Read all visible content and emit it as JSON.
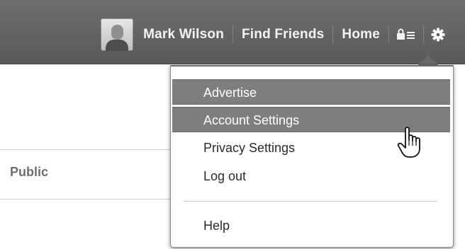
{
  "header": {
    "user_name": "Mark Wilson",
    "find_friends": "Find Friends",
    "home": "Home",
    "privacy_icon": "privacy-shortcuts-icon",
    "settings_icon": "gear-icon",
    "background_color": "#5f5f5f"
  },
  "page": {
    "audience_label": "Public"
  },
  "dropdown": {
    "items": [
      {
        "label": "Advertise",
        "state": "highlighted"
      },
      {
        "label": "Account Settings",
        "state": "hovered"
      },
      {
        "label": "Privacy Settings",
        "state": "normal"
      },
      {
        "label": "Log out",
        "state": "normal"
      },
      {
        "label": "Help",
        "state": "normal"
      }
    ],
    "highlight_color": "#7e7e7e"
  },
  "cursor": "hand-pointer-icon"
}
